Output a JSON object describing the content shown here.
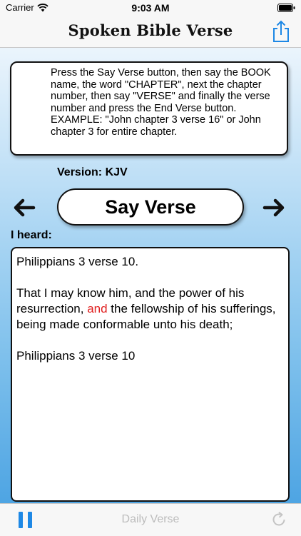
{
  "status_bar": {
    "carrier": "Carrier",
    "time": "9:03 AM",
    "wifi_icon": "wifi-icon",
    "battery_icon": "battery-icon"
  },
  "nav": {
    "title": "Spoken Bible Verse",
    "share_icon": "share-icon"
  },
  "instructions": {
    "text": "Press the Say Verse button, then say the BOOK name, the word \"CHAPTER\", next the chapter number, then say \"VERSE\" and finally the verse number and press the End Verse button. EXAMPLE: \"John chapter 3 verse 16\" or John chapter 3 for entire chapter."
  },
  "version": {
    "label": "Version: KJV"
  },
  "controls": {
    "prev_icon": "arrow-left-icon",
    "next_icon": "arrow-right-icon",
    "say_verse_label": "Say Verse"
  },
  "heard": {
    "label": "I heard:"
  },
  "verse": {
    "reference_top": "Philippians 3 verse 10.",
    "text_before": "That I may know him, and the power of his resurrection, ",
    "text_highlight": "and",
    "text_after": " the fellowship of his sufferings, being made conformable unto his death;",
    "reference_bottom": "Philippians 3 verse 10",
    "highlight_color": "#e02020"
  },
  "tab_bar": {
    "pause_icon": "pause-icon",
    "daily_verse_label": "Daily Verse",
    "refresh_icon": "refresh-icon",
    "accent_color": "#1e88e5"
  }
}
